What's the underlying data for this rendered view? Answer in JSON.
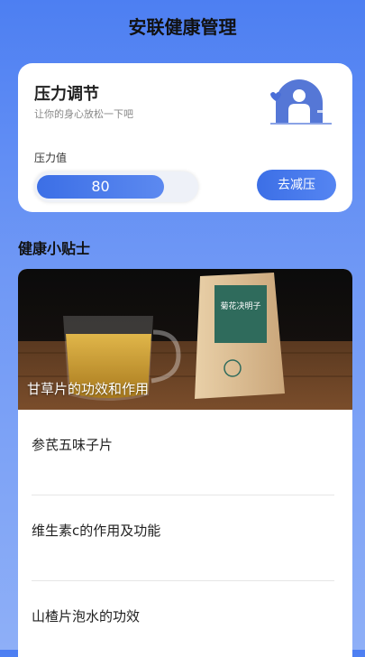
{
  "app": {
    "title": "安联健康管理"
  },
  "stress_card": {
    "title": "压力调节",
    "subtitle": "让你的身心放松一下吧",
    "value_label": "压力值",
    "value": "80",
    "fill_fraction": 0.8,
    "button_label": "去减压"
  },
  "tips": {
    "section_title": "健康小贴士",
    "featured_caption": "甘草片的功效和作用",
    "product_label_text": "菊花决明子",
    "items": [
      {
        "title": "参芪五味子片"
      },
      {
        "title": "维生素c的作用及功能"
      },
      {
        "title": "山楂片泡水的功效"
      }
    ]
  },
  "colors": {
    "accent": "#3c6fe6",
    "background": "#5b88f3"
  }
}
